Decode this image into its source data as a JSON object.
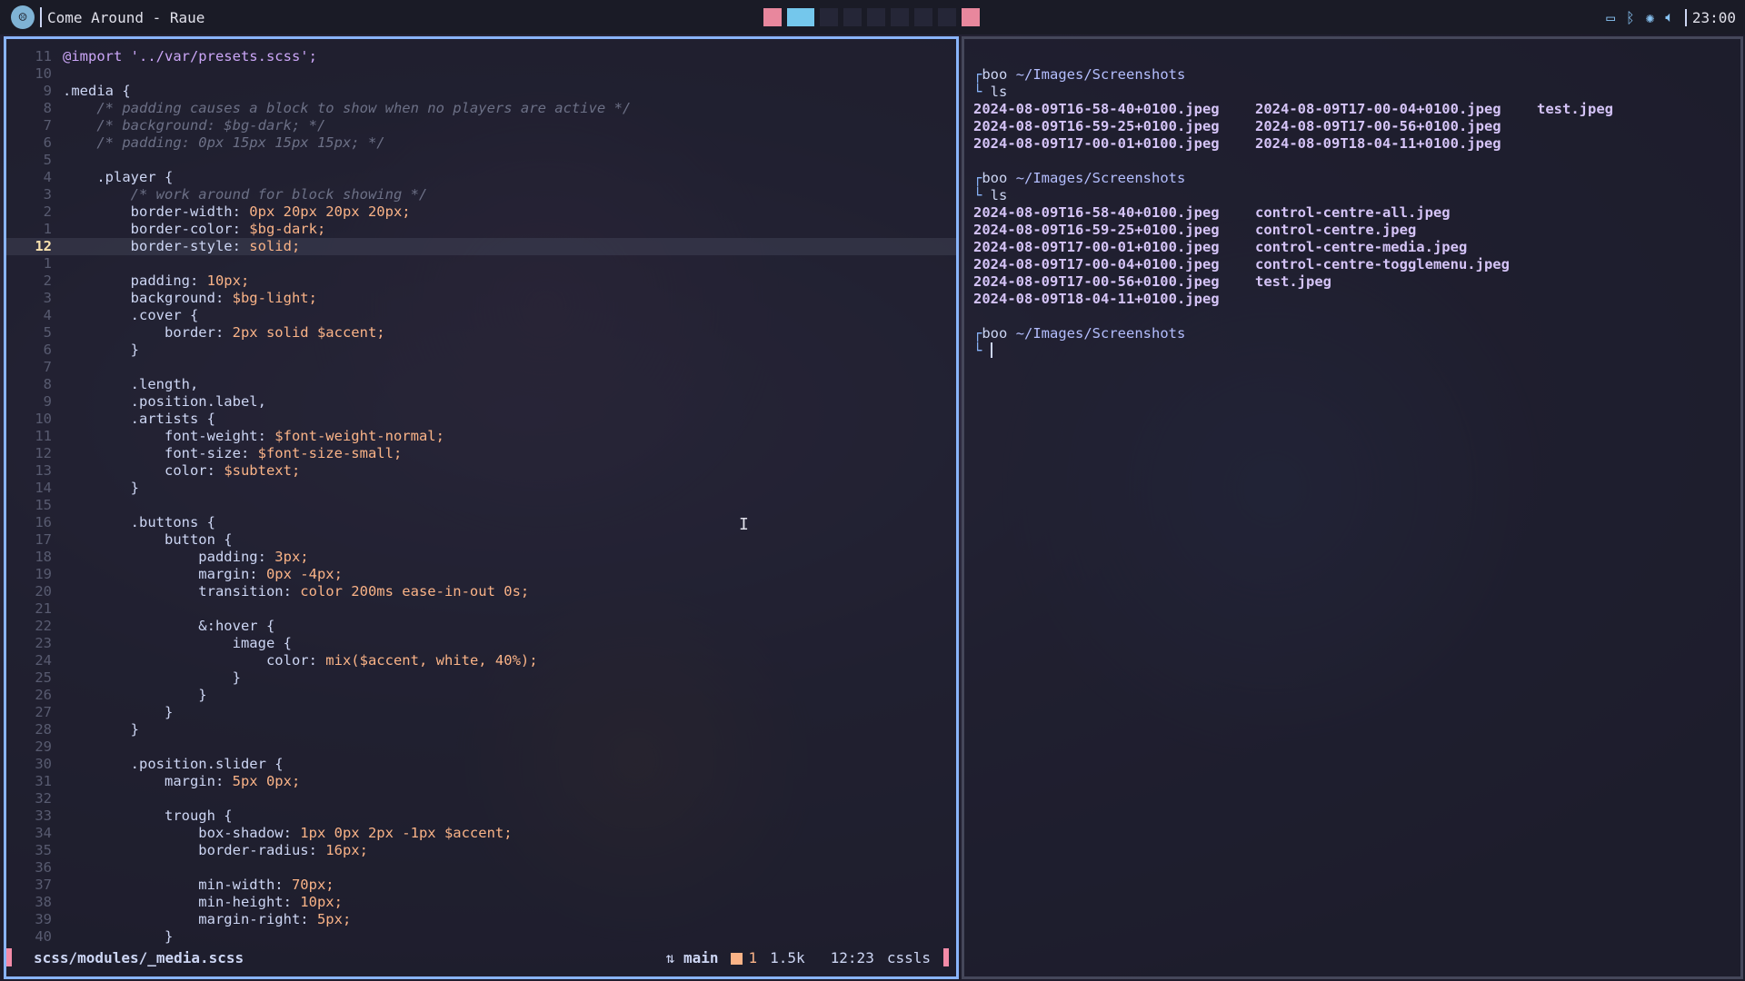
{
  "topbar": {
    "window_title": "Come Around - Raue",
    "workspaces": [
      "occ",
      "act",
      "e",
      "e",
      "e",
      "e",
      "e",
      "e",
      "occ"
    ],
    "clock": "23:00",
    "tray_icons": [
      "monitor-icon",
      "bluetooth-icon",
      "brightness-icon",
      "volume-icon"
    ]
  },
  "editor": {
    "lines": [
      {
        "n": "11",
        "t": "@import '../var/presets.scss';",
        "k": "at"
      },
      {
        "n": "10",
        "t": "",
        "k": "code"
      },
      {
        "n": "9",
        "t": ".media {",
        "k": "sel"
      },
      {
        "n": "8",
        "t": "    /* padding causes a block to show when no players are active */",
        "k": "comment"
      },
      {
        "n": "7",
        "t": "    /* background: $bg-dark; */",
        "k": "comment"
      },
      {
        "n": "6",
        "t": "    /* padding: 0px 15px 15px 15px; */",
        "k": "comment"
      },
      {
        "n": "5",
        "t": "",
        "k": "code"
      },
      {
        "n": "4",
        "t": "    .player {",
        "k": "sel"
      },
      {
        "n": "3",
        "t": "        /* work around for block showing */",
        "k": "comment"
      },
      {
        "n": "2",
        "t": "        border-width: 0px 20px 20px 20px;",
        "k": "prop"
      },
      {
        "n": "1",
        "t": "        border-color: $bg-dark;",
        "k": "prop"
      },
      {
        "n": "12",
        "t": "        border-style: solid;",
        "k": "prop",
        "cur": true
      },
      {
        "n": "1",
        "t": "",
        "k": "code"
      },
      {
        "n": "2",
        "t": "        padding: 10px;",
        "k": "prop"
      },
      {
        "n": "3",
        "t": "        background: $bg-light;",
        "k": "prop"
      },
      {
        "n": "4",
        "t": "        .cover {",
        "k": "sel"
      },
      {
        "n": "5",
        "t": "            border: 2px solid $accent;",
        "k": "prop"
      },
      {
        "n": "6",
        "t": "        }",
        "k": "sel"
      },
      {
        "n": "7",
        "t": "",
        "k": "code"
      },
      {
        "n": "8",
        "t": "        .length,",
        "k": "sel"
      },
      {
        "n": "9",
        "t": "        .position.label,",
        "k": "sel"
      },
      {
        "n": "10",
        "t": "        .artists {",
        "k": "sel"
      },
      {
        "n": "11",
        "t": "            font-weight: $font-weight-normal;",
        "k": "prop"
      },
      {
        "n": "12",
        "t": "            font-size: $font-size-small;",
        "k": "prop"
      },
      {
        "n": "13",
        "t": "            color: $subtext;",
        "k": "prop"
      },
      {
        "n": "14",
        "t": "        }",
        "k": "sel"
      },
      {
        "n": "15",
        "t": "",
        "k": "code"
      },
      {
        "n": "16",
        "t": "        .buttons {",
        "k": "sel"
      },
      {
        "n": "17",
        "t": "            button {",
        "k": "sel"
      },
      {
        "n": "18",
        "t": "                padding: 3px;",
        "k": "prop"
      },
      {
        "n": "19",
        "t": "                margin: 0px -4px;",
        "k": "prop"
      },
      {
        "n": "20",
        "t": "                transition: color 200ms ease-in-out 0s;",
        "k": "prop"
      },
      {
        "n": "21",
        "t": "",
        "k": "code"
      },
      {
        "n": "22",
        "t": "                &:hover {",
        "k": "sel"
      },
      {
        "n": "23",
        "t": "                    image {",
        "k": "sel"
      },
      {
        "n": "24",
        "t": "                        color: mix($accent, white, 40%);",
        "k": "prop"
      },
      {
        "n": "25",
        "t": "                    }",
        "k": "sel"
      },
      {
        "n": "26",
        "t": "                }",
        "k": "sel"
      },
      {
        "n": "27",
        "t": "            }",
        "k": "sel"
      },
      {
        "n": "28",
        "t": "        }",
        "k": "sel"
      },
      {
        "n": "29",
        "t": "",
        "k": "code"
      },
      {
        "n": "30",
        "t": "        .position.slider {",
        "k": "sel"
      },
      {
        "n": "31",
        "t": "            margin: 5px 0px;",
        "k": "prop"
      },
      {
        "n": "32",
        "t": "",
        "k": "code"
      },
      {
        "n": "33",
        "t": "            trough {",
        "k": "sel"
      },
      {
        "n": "34",
        "t": "                box-shadow: 1px 0px 2px -1px $accent;",
        "k": "prop"
      },
      {
        "n": "35",
        "t": "                border-radius: 16px;",
        "k": "prop"
      },
      {
        "n": "36",
        "t": "",
        "k": "code"
      },
      {
        "n": "37",
        "t": "                min-width: 70px;",
        "k": "prop"
      },
      {
        "n": "38",
        "t": "                min-height: 10px;",
        "k": "prop"
      },
      {
        "n": "39",
        "t": "                margin-right: 5px;",
        "k": "prop"
      },
      {
        "n": "40",
        "t": "            }",
        "k": "sel"
      }
    ],
    "status": {
      "file": "scss/modules/_media.scss",
      "branch": "main",
      "diagnostics": "1",
      "size": "1.5k",
      "position": "12:23",
      "lsp": "cssls"
    }
  },
  "terminal": {
    "user": "boo",
    "cwd": "~/Images/Screenshots",
    "command": "ls",
    "outputs": [
      [
        [
          "2024-08-09T16-58-40+0100.jpeg",
          "2024-08-09T17-00-04+0100.jpeg",
          "test.jpeg"
        ],
        [
          "2024-08-09T16-59-25+0100.jpeg",
          "2024-08-09T17-00-56+0100.jpeg"
        ],
        [
          "2024-08-09T17-00-01+0100.jpeg",
          "2024-08-09T18-04-11+0100.jpeg"
        ]
      ],
      [
        [
          "2024-08-09T16-58-40+0100.jpeg",
          "control-centre-all.jpeg"
        ],
        [
          "2024-08-09T16-59-25+0100.jpeg",
          "control-centre.jpeg"
        ],
        [
          "2024-08-09T17-00-01+0100.jpeg",
          "control-centre-media.jpeg"
        ],
        [
          "2024-08-09T17-00-04+0100.jpeg",
          "control-centre-togglemenu.jpeg"
        ],
        [
          "2024-08-09T17-00-56+0100.jpeg",
          "test.jpeg"
        ],
        [
          "2024-08-09T18-04-11+0100.jpeg"
        ]
      ]
    ]
  }
}
